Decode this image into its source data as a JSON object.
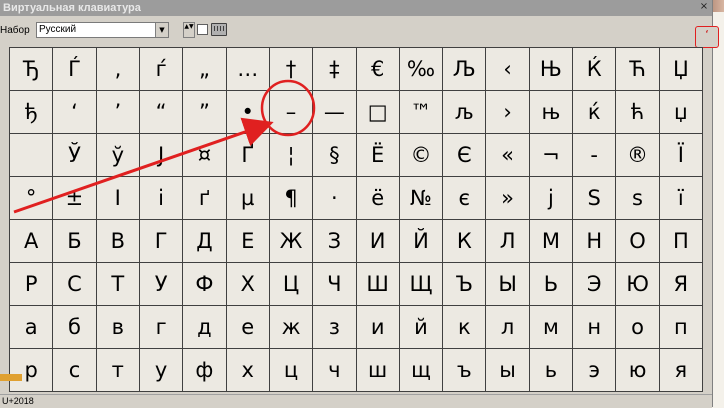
{
  "window": {
    "title": "Виртуальная клавиатура",
    "close_glyph": "×"
  },
  "toolbar": {
    "set_label": "Набор",
    "set_value": "Русский",
    "dropdown_glyph": "▼",
    "spin_glyph": "▲▼",
    "side_button_glyph": "‘"
  },
  "keys": [
    [
      "Ђ",
      "Ѓ",
      "‚",
      "ѓ",
      "„",
      "…",
      "†",
      "‡",
      "€",
      "‰",
      "Љ",
      "‹",
      "Њ",
      "Ќ",
      "Ћ",
      "Џ"
    ],
    [
      "ђ",
      "‘",
      "’",
      "“",
      "”",
      "•",
      "–",
      "—",
      "□",
      "™",
      "љ",
      "›",
      "њ",
      "ќ",
      "ћ",
      "џ"
    ],
    [
      "",
      "Ў",
      "ў",
      "Ј",
      "¤",
      "Ґ",
      "¦",
      "§",
      "Ё",
      "©",
      "Є",
      "«",
      "¬",
      "-",
      "®",
      "Ї"
    ],
    [
      "°",
      "±",
      "І",
      "і",
      "ґ",
      "µ",
      "¶",
      "·",
      "ё",
      "№",
      "є",
      "»",
      "ј",
      "Ѕ",
      "ѕ",
      "ї"
    ],
    [
      "А",
      "Б",
      "В",
      "Г",
      "Д",
      "Е",
      "Ж",
      "З",
      "И",
      "Й",
      "К",
      "Л",
      "М",
      "Н",
      "О",
      "П"
    ],
    [
      "Р",
      "С",
      "Т",
      "У",
      "Ф",
      "Х",
      "Ц",
      "Ч",
      "Ш",
      "Щ",
      "Ъ",
      "Ы",
      "Ь",
      "Э",
      "Ю",
      "Я"
    ],
    [
      "а",
      "б",
      "в",
      "г",
      "д",
      "е",
      "ж",
      "з",
      "и",
      "й",
      "к",
      "л",
      "м",
      "н",
      "о",
      "п"
    ],
    [
      "р",
      "с",
      "т",
      "у",
      "ф",
      "х",
      "ц",
      "ч",
      "ш",
      "щ",
      "ъ",
      "ы",
      "ь",
      "э",
      "ю",
      "я"
    ]
  ],
  "status": {
    "text": "U+2018"
  },
  "annotation": {
    "circle_color": "#e02020",
    "arrow_color": "#e02020",
    "highlighted_key": "–"
  }
}
